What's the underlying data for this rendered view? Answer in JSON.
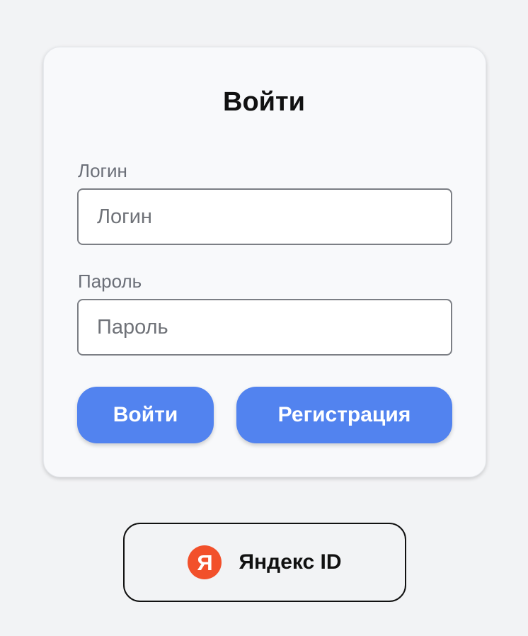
{
  "login_form": {
    "title": "Войти",
    "login_label": "Логин",
    "login_placeholder": "Логин",
    "login_value": "",
    "password_label": "Пароль",
    "password_placeholder": "Пароль",
    "password_value": "",
    "submit_label": "Войти",
    "register_label": "Регистрация"
  },
  "yandex_id": {
    "logo_letter": "Я",
    "label": "Яндекс ID"
  },
  "colors": {
    "page_background": "#f2f3f5",
    "card_background": "#f8f9fb",
    "primary_button": "#5283ef",
    "yandex_logo": "#f2502b"
  },
  "icons": {
    "yandex_logo": "yandex-logo-icon"
  }
}
